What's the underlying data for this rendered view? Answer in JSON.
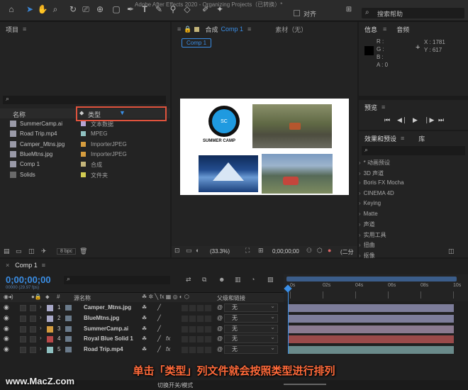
{
  "window": {
    "title": "Adobe After Effects 2020 - Organizing Projects（已转换）*"
  },
  "toolbar": {
    "snap_label": "对齐",
    "search_placeholder": "搜索帮助"
  },
  "project": {
    "title": "项目",
    "search_placeholder": "",
    "col_name": "名称",
    "col_type": "类型",
    "bpc": "8 bpc",
    "items": [
      {
        "name": "SummerCamp.ai",
        "type": "文本数据",
        "color": "#b5a5d4"
      },
      {
        "name": "Road Trip.mp4",
        "type": "MPEG",
        "color": "#8fc0c0"
      },
      {
        "name": "Camper_Mtns.jpg",
        "type": "ImporterJPEG",
        "color": "#d59c3e"
      },
      {
        "name": "BlueMtns.jpg",
        "type": "ImporterJPEG",
        "color": "#d59c3e"
      },
      {
        "name": "Comp 1",
        "type": "合成",
        "color": "#c4b57a"
      },
      {
        "name": "Solids",
        "type": "文件夹",
        "color": "#d2cc52"
      }
    ]
  },
  "comp_viewer": {
    "comp_label": "合成",
    "comp_name": "Comp 1",
    "footage_label": "素材（无）",
    "tab": "Comp 1",
    "zoom": "(33.3%)",
    "timecode": "0;00;00;00",
    "view_label": "(二分",
    "logo_text": "SUMMER CAMP",
    "logo_inner": "SC"
  },
  "info": {
    "tab_info": "信息",
    "tab_audio": "音频",
    "r": "R :",
    "g": "G :",
    "b": "B :",
    "a": "A : 0",
    "x": "X : 1781",
    "y": "Y : 617"
  },
  "preview": {
    "title": "预览"
  },
  "effects": {
    "title": "效果和预设",
    "tab_lib": "库",
    "items": [
      "* 动画预设",
      "3D 声道",
      "Boris FX Mocha",
      "CINEMA 4D",
      "Keying",
      "Matte",
      "声道",
      "实用工具",
      "扭曲",
      "抠像"
    ]
  },
  "timeline": {
    "tab": "Comp 1",
    "timecode": "0;00;00;00",
    "fps": "00000 (29.97 fps)",
    "col_source": "源名称",
    "col_parent": "父级和链接",
    "none": "无",
    "switch_mode": "切换开关/模式",
    "ticks": [
      "0s",
      "02s",
      "04s",
      "06s",
      "08s",
      "10s"
    ],
    "layers": [
      {
        "num": "1",
        "name": "Camper_Mtns.jpg",
        "color": "#a8a8c8",
        "bar": "#7d7d9a",
        "fx": ""
      },
      {
        "num": "2",
        "name": "BlueMtns.jpg",
        "color": "#a8a8c8",
        "bar": "#7d7d9a",
        "fx": ""
      },
      {
        "num": "3",
        "name": "SummerCamp.ai",
        "color": "#d59c3e",
        "bar": "#8a7a90",
        "fx": ""
      },
      {
        "num": "4",
        "name": "Royal Blue Solid 1",
        "color": "#b84848",
        "bar": "#9a4a4a",
        "fx": "fx"
      },
      {
        "num": "5",
        "name": "Road Trip.mp4",
        "color": "#8fc0c0",
        "bar": "#6a8a8a",
        "fx": "fx"
      }
    ]
  },
  "caption": "单击「类型」列文件就会按照类型进行排列",
  "watermark": "www.MacZ.com"
}
